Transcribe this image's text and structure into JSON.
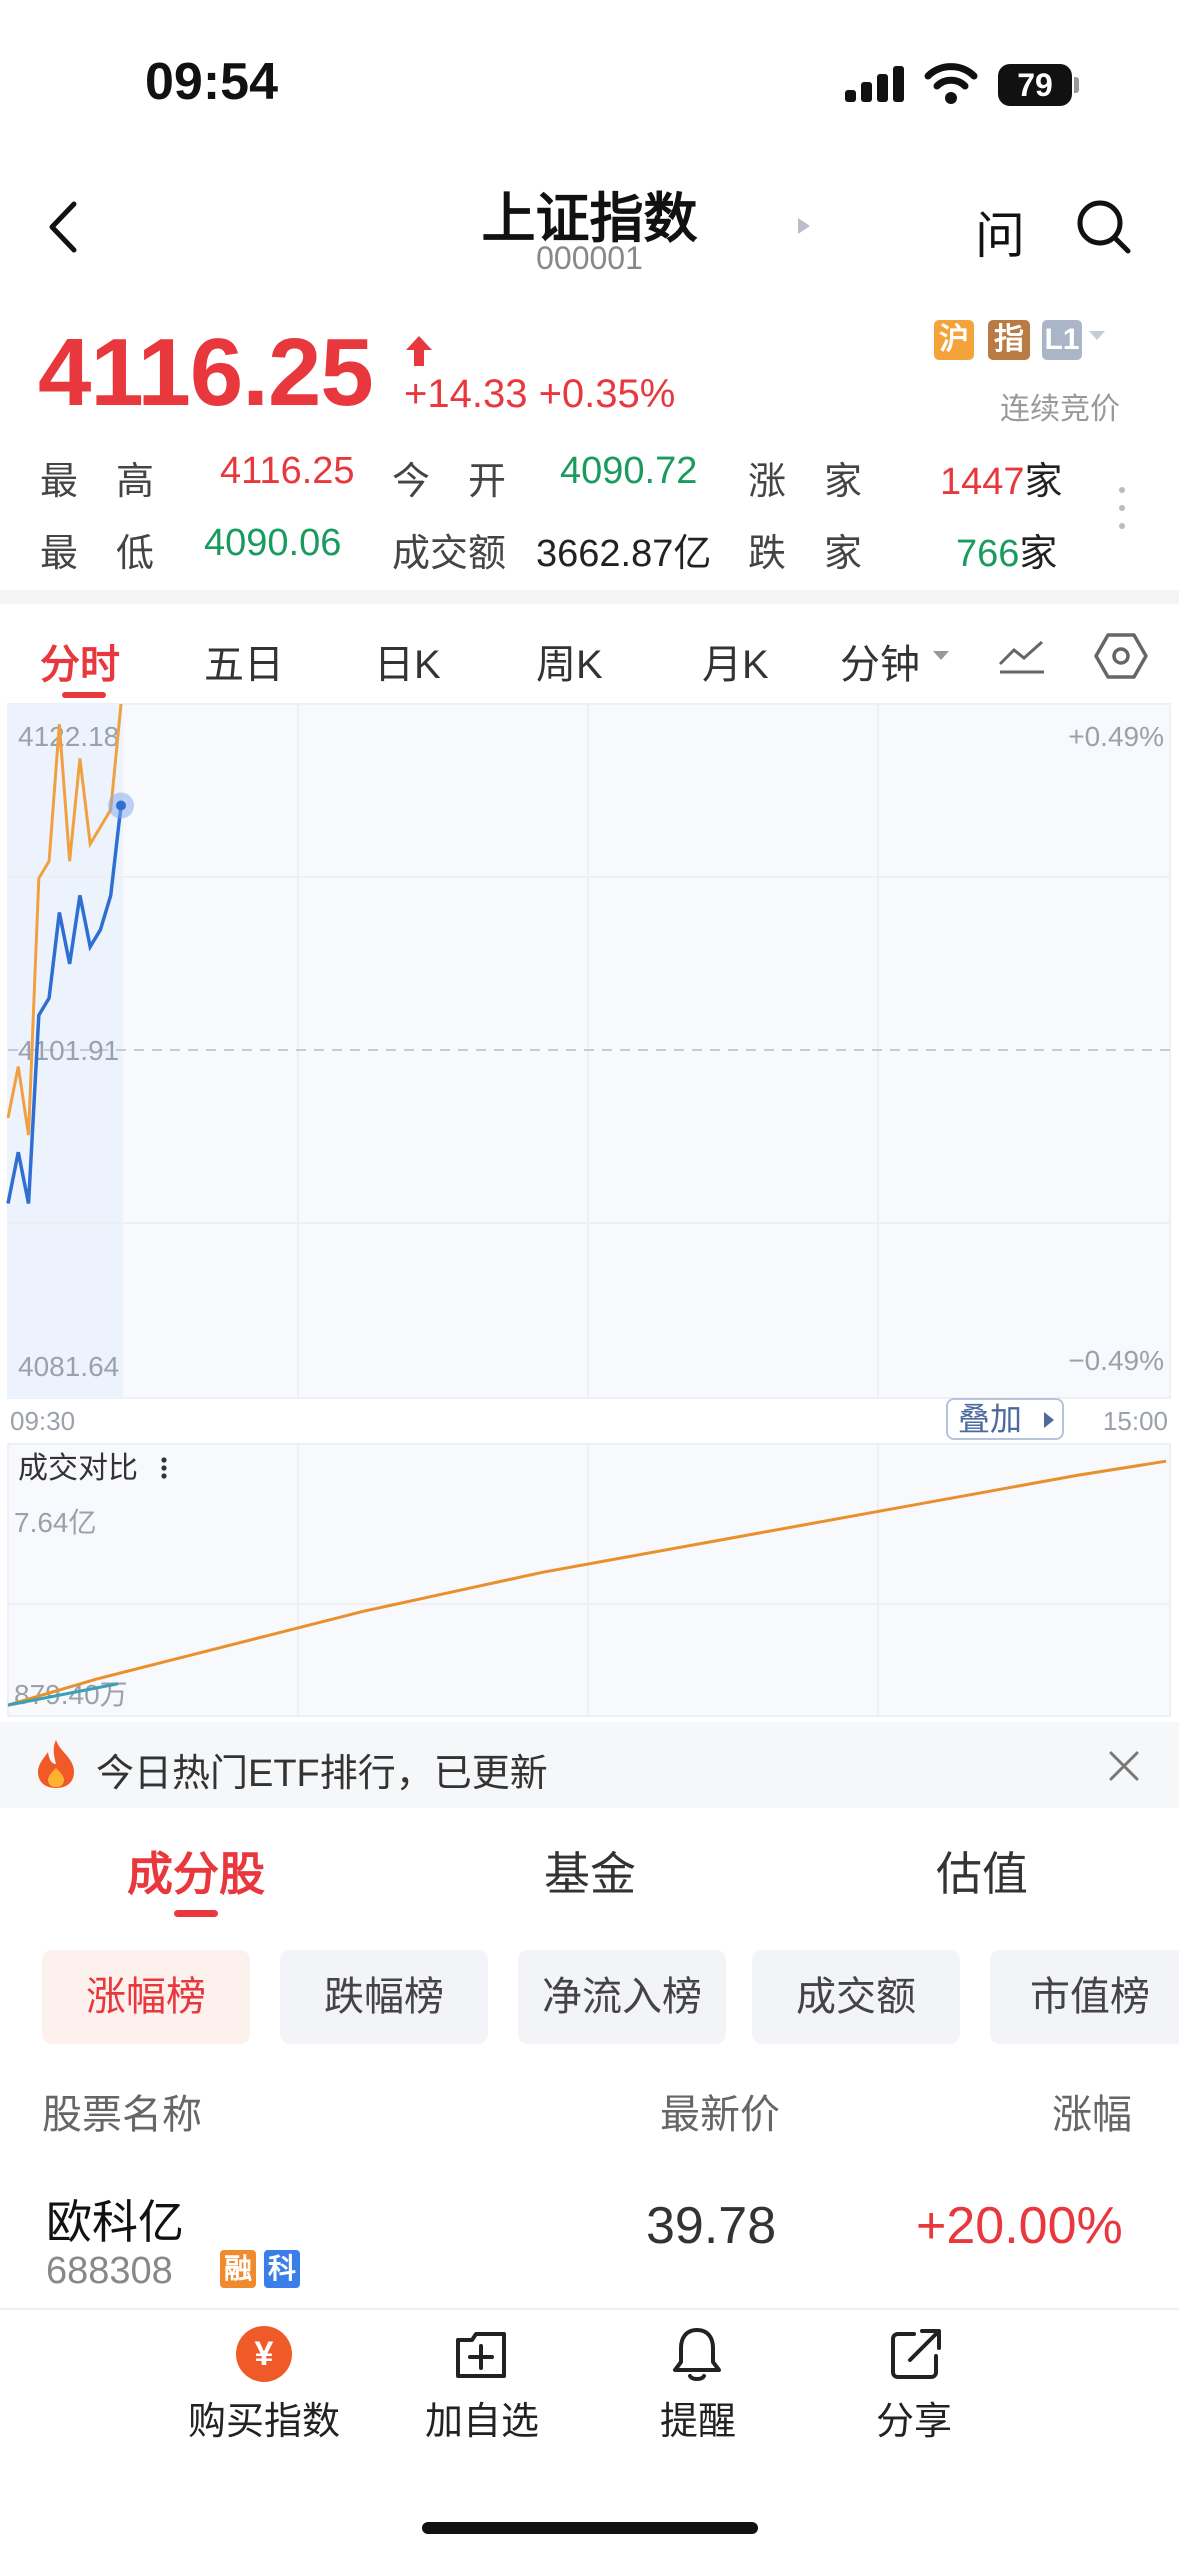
{
  "status_bar": {
    "time": "09:54",
    "battery": "79"
  },
  "nav": {
    "title": "上证指数",
    "code": "000001",
    "ask_label": "问"
  },
  "quote": {
    "price": "4116.25",
    "change": "+14.33 +0.35%",
    "tags": [
      "沪",
      "指",
      "L1"
    ],
    "auction_label": "连续竞价"
  },
  "stats": {
    "high_label": "最　高",
    "high": "4116.25",
    "open_label": "今　开",
    "open": "4090.72",
    "up_label": "涨　家",
    "up_count": "1447",
    "up_unit": "家",
    "low_label": "最　低",
    "low": "4090.06",
    "turnover_label": "成交额",
    "turnover": "3662.87亿",
    "down_label": "跌　家",
    "down_count": "766",
    "down_unit": "家"
  },
  "chart_tabs": [
    "分时",
    "五日",
    "日K",
    "周K",
    "月K",
    "分钟"
  ],
  "colors": {
    "up": "#e8383d",
    "down": "#1a9b5e",
    "index_line": "#2f6fd1",
    "avg_line": "#f0a040"
  },
  "price_chart": {
    "y_top_label": "4122.18",
    "y_mid_label": "4101.91",
    "y_bottom_label": "4081.64",
    "pct_top_label": "+0.49%",
    "pct_bottom_label": "−0.49%",
    "time_start": "09:30",
    "time_end": "15:00",
    "overlay_label": "叠加"
  },
  "volume_chart": {
    "title": "成交对比",
    "top_label": "7.64亿",
    "bottom_label": "879.40万"
  },
  "chart_data": {
    "type": "line",
    "x_range": [
      "09:30",
      "15:00"
    ],
    "ylim": [
      4081.64,
      4122.18
    ],
    "series": [
      {
        "values": [
          4093,
          4096,
          4093,
          4104,
          4105,
          4110,
          4107,
          4111,
          4108,
          4109,
          4111,
          4116.25
        ]
      },
      {
        "values": [
          4098,
          4101,
          4097,
          4112,
          4113,
          4121,
          4113,
          4119,
          4114,
          4115,
          4116,
          4122.18
        ]
      }
    ],
    "volume_series": [
      0.09,
      0.9,
      1.6,
      2.3,
      3.0,
      3.6,
      4.2,
      4.7,
      5.2,
      5.7,
      6.2,
      6.7,
      7.2,
      7.64
    ]
  },
  "promo": {
    "text": "今日热门ETF排行，已更新"
  },
  "section_tabs": [
    "成分股",
    "基金",
    "估值"
  ],
  "filters": [
    "涨幅榜",
    "跌幅榜",
    "净流入榜",
    "成交额",
    "市值榜"
  ],
  "table": {
    "headers": {
      "name": "股票名称",
      "price": "最新价",
      "change": "涨幅"
    },
    "rows": [
      {
        "name": "欧科亿",
        "code": "688308",
        "badges": [
          "融",
          "科"
        ],
        "price": "39.78",
        "change": "+20.00%"
      }
    ]
  },
  "bottom_bar": {
    "buy": "购买指数",
    "watch": "加自选",
    "alert": "提醒",
    "share": "分享",
    "buy_icon_glyph": "¥"
  }
}
